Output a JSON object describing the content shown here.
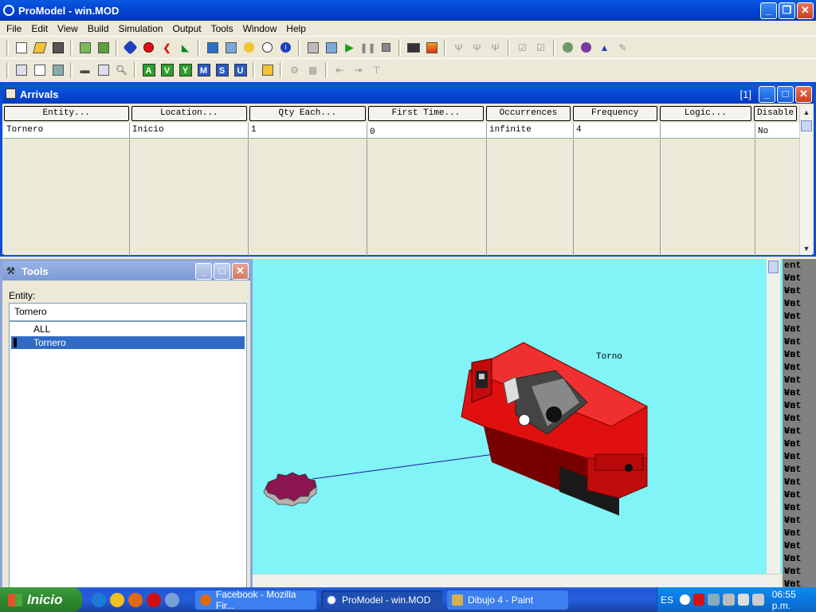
{
  "app": {
    "title": "ProModel - win.MOD"
  },
  "menu": [
    "File",
    "Edit",
    "View",
    "Build",
    "Simulation",
    "Output",
    "Tools",
    "Window",
    "Help"
  ],
  "arrivals": {
    "title": "Arrivals",
    "counter": "[1]",
    "columns": [
      "Entity...",
      "Location...",
      "Qty Each...",
      "First Time...",
      "Occurrences",
      "Frequency",
      "Logic...",
      "Disable"
    ],
    "rows": [
      [
        "Tornero",
        "Inicio",
        "1",
        "0",
        "infinite",
        "4",
        "",
        "No"
      ]
    ]
  },
  "tools": {
    "title": "Tools",
    "entity_label": "Entity:",
    "entity_value": "Tornero",
    "list": [
      "ALL",
      "Tornero"
    ],
    "selected": "Tornero"
  },
  "layout": {
    "location_label": "Torno"
  },
  "right_strip_text": "ent Ve",
  "taskbar": {
    "start": "Inicio",
    "tasks": [
      "Facebook - Mozilla Fir...",
      "ProModel - win.MOD",
      "Dibujo 4 - Paint"
    ],
    "lang": "ES",
    "clock": "06:55 p.m."
  },
  "colors": {
    "xp_blue": "#0339c2",
    "canvas_bg": "#80f4f6",
    "machine_red": "#e01010",
    "gear_purple": "#8a1550"
  }
}
